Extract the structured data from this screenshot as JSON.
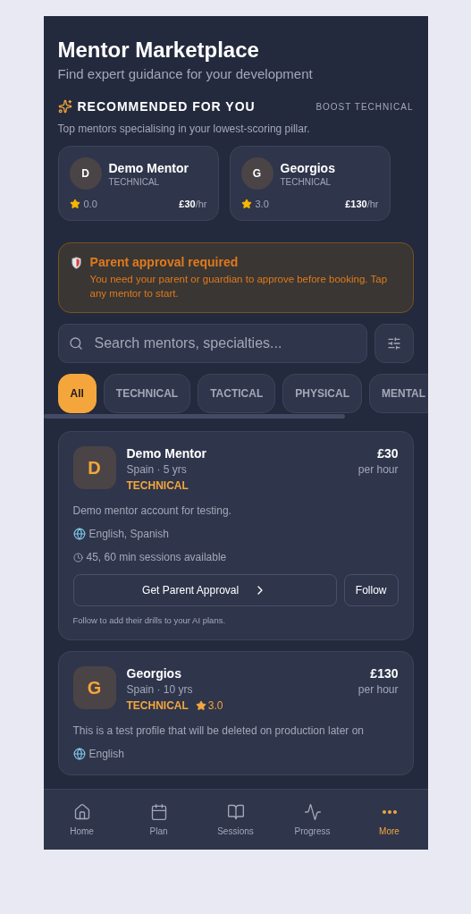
{
  "header": {
    "title": "Mentor Marketplace",
    "subtitle": "Find expert guidance for your development"
  },
  "recommended": {
    "title": "RECOMMENDED FOR YOU",
    "action": "BOOST TECHNICAL",
    "description": "Top mentors specialising in your lowest-scoring pillar.",
    "mentors": [
      {
        "initial": "D",
        "name": "Demo Mentor",
        "pillar": "TECHNICAL",
        "rating": "0.0",
        "price": "£30",
        "unit": "/hr"
      },
      {
        "initial": "G",
        "name": "Georgios",
        "pillar": "TECHNICAL",
        "rating": "3.0",
        "price": "£130",
        "unit": "/hr"
      }
    ]
  },
  "notice": {
    "title": "Parent approval required",
    "message": "You need your parent or guardian to approve before booking. Tap any mentor to start."
  },
  "search": {
    "placeholder": "Search mentors, specialties..."
  },
  "filters": [
    {
      "label": "All",
      "selected": true
    },
    {
      "label": "TECHNICAL",
      "selected": false
    },
    {
      "label": "TACTICAL",
      "selected": false
    },
    {
      "label": "PHYSICAL",
      "selected": false
    },
    {
      "label": "MENTAL",
      "selected": false
    }
  ],
  "mentors": [
    {
      "initial": "D",
      "name": "Demo Mentor",
      "meta": "Spain · 5 yrs",
      "pillar": "TECHNICAL",
      "price": "£30",
      "unit": "per hour",
      "bio": "Demo mentor account for testing.",
      "languages": "English, Spanish",
      "sessions": "45, 60 min sessions available",
      "primary_action": "Get Parent Approval",
      "follow": "Follow",
      "hint": "Follow to add their drills to your AI plans."
    },
    {
      "initial": "G",
      "name": "Georgios",
      "meta": "Spain · 10 yrs",
      "pillar": "TECHNICAL",
      "rating": "3.0",
      "price": "£130",
      "unit": "per hour",
      "bio": "This is a test profile that will be deleted on production later on",
      "languages": "English"
    }
  ],
  "nav": [
    {
      "label": "Home",
      "selected": false
    },
    {
      "label": "Plan",
      "selected": false
    },
    {
      "label": "Sessions",
      "selected": false
    },
    {
      "label": "Progress",
      "selected": false
    },
    {
      "label": "More",
      "selected": true
    }
  ]
}
